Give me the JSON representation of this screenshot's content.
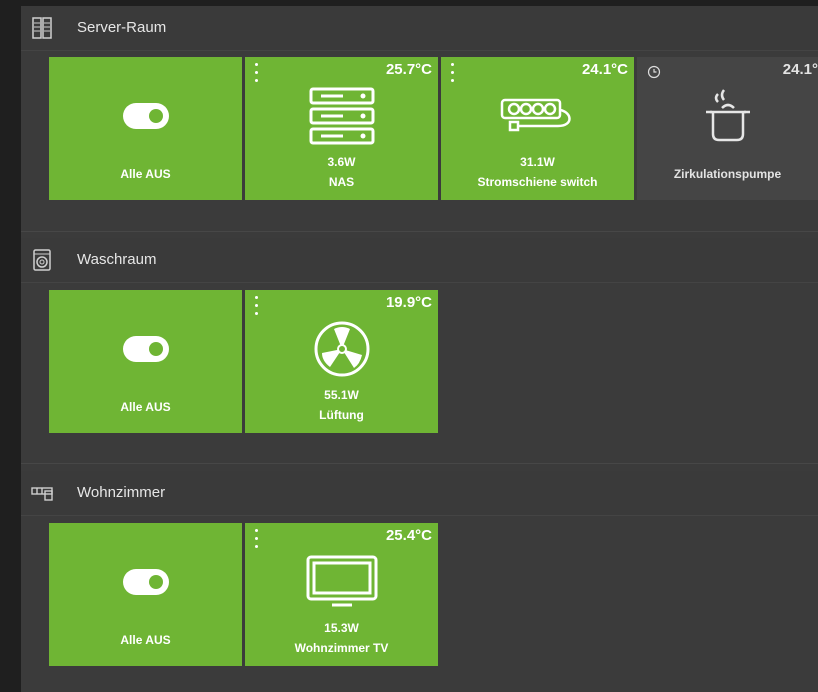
{
  "sections": [
    {
      "title": "Server-Raum",
      "icon": "server-rack-icon",
      "tiles": [
        {
          "label": "Alle AUS",
          "icon": "toggle-on-icon"
        },
        {
          "temp": "25.7°C",
          "power": "3.6W",
          "label": "NAS",
          "icon": "nas-server-icon"
        },
        {
          "temp": "24.1°C",
          "power": "31.1W",
          "label": "Stromschiene switch",
          "icon": "power-strip-icon"
        },
        {
          "temp": "24.1°",
          "label": "Zirkulationspumpe",
          "icon": "cooking-pot-icon",
          "state": "off"
        }
      ]
    },
    {
      "title": "Waschraum",
      "icon": "washing-machine-icon",
      "tiles": [
        {
          "label": "Alle AUS",
          "icon": "toggle-on-icon"
        },
        {
          "temp": "19.9°C",
          "power": "55.1W",
          "label": "Lüftung",
          "icon": "fan-icon"
        }
      ]
    },
    {
      "title": "Wohnzimmer",
      "icon": "sofa-icon",
      "tiles": [
        {
          "label": "Alle AUS",
          "icon": "toggle-on-icon"
        },
        {
          "temp": "25.4°C",
          "power": "15.3W",
          "label": "Wohnzimmer TV",
          "icon": "tv-icon"
        }
      ]
    }
  ],
  "colors": {
    "active": "#6fb534",
    "inactive": "#454545",
    "background": "#3b3b3b"
  }
}
